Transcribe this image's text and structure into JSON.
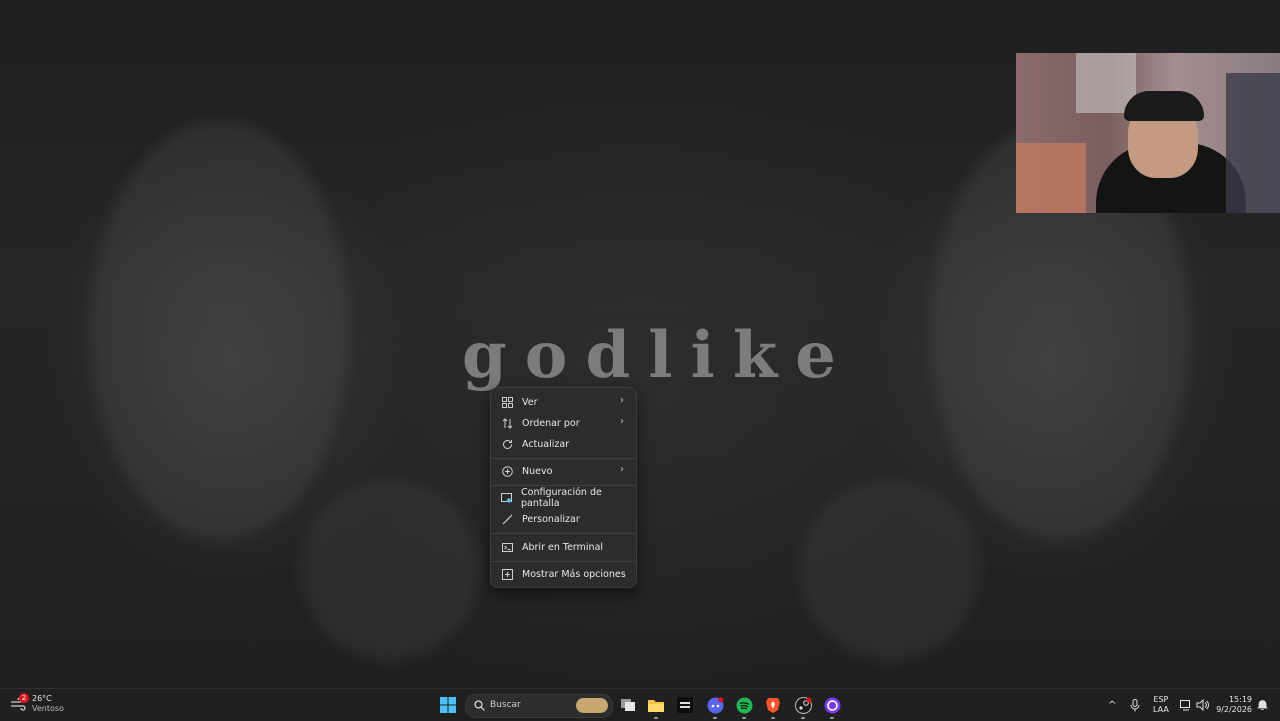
{
  "wallpaper": {
    "title": "godlike"
  },
  "context_menu": {
    "items": [
      {
        "label": "Ver",
        "icon": "grid-view-icon",
        "submenu": true
      },
      {
        "label": "Ordenar por",
        "icon": "sort-icon",
        "submenu": true
      },
      {
        "label": "Actualizar",
        "icon": "refresh-icon",
        "submenu": false
      },
      {
        "label": "Nuevo",
        "icon": "add-circle-icon",
        "submenu": true
      },
      {
        "label": "Configuración de pantalla",
        "icon": "display-settings-icon",
        "submenu": false
      },
      {
        "label": "Personalizar",
        "icon": "brush-icon",
        "submenu": false
      },
      {
        "label": "Abrir en Terminal",
        "icon": "terminal-icon",
        "submenu": false
      },
      {
        "label": "Mostrar Más opciones",
        "icon": "more-options-icon",
        "submenu": false
      }
    ]
  },
  "taskbar": {
    "weather": {
      "temp": "26°C",
      "condition": "Ventoso",
      "badge": "2"
    },
    "search": {
      "placeholder": "Buscar"
    },
    "apps": [
      "start-icon",
      "task-view-icon",
      "file-explorer-icon",
      "call-of-duty-icon",
      "discord-icon",
      "spotify-icon",
      "brave-icon",
      "steam-icon",
      "app-icon"
    ],
    "tray": {
      "language": "ESP",
      "layout": "LAA",
      "time": "15:19",
      "date": "9/2/2026"
    }
  },
  "colors": {
    "accent": "#4cc2ff",
    "spotify": "#1db954",
    "discord": "#5865f2",
    "brave": "#fb542b",
    "notify": "#e81123"
  }
}
